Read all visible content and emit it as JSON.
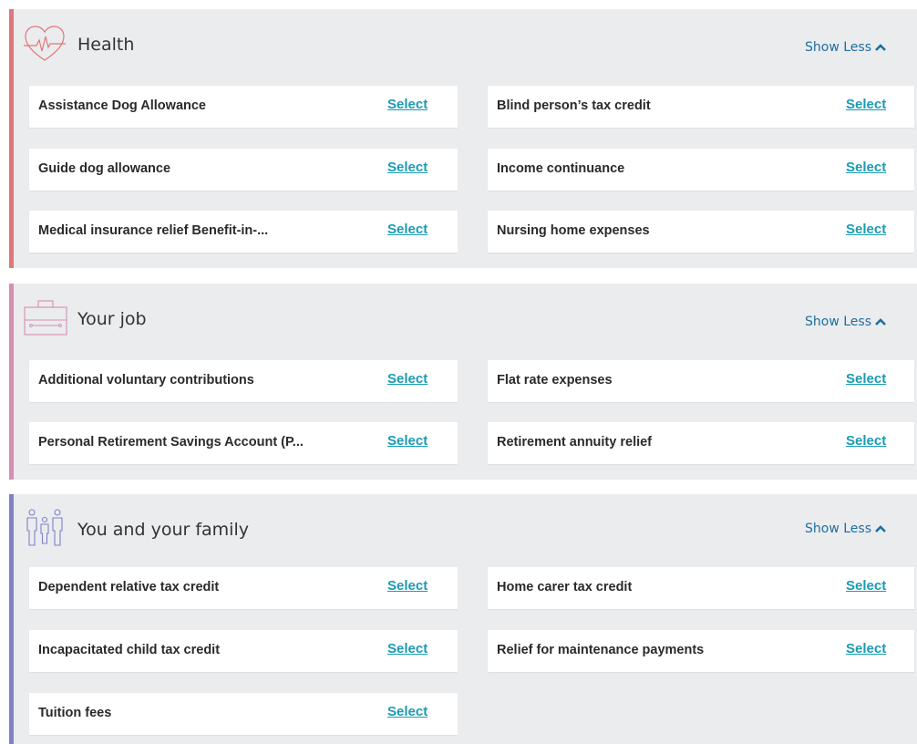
{
  "colors": {
    "health_accent": "#e0777b",
    "job_accent": "#d58fb3",
    "family_accent": "#8181c7",
    "section_bg": "#ebecee",
    "link": "#1a9bb4",
    "show_less": "#1d6f9f"
  },
  "sections": [
    {
      "title": "Health",
      "icon": "heart-pulse-icon",
      "toggle_label": "Show Less",
      "items": [
        {
          "label": "Assistance Dog Allowance",
          "action": "Select"
        },
        {
          "label": "Blind person’s tax credit",
          "action": "Select"
        },
        {
          "label": "Guide dog allowance",
          "action": "Select"
        },
        {
          "label": "Income continuance",
          "action": "Select"
        },
        {
          "label": "Medical insurance relief  Benefit-in-...",
          "action": "Select"
        },
        {
          "label": "Nursing home expenses",
          "action": "Select"
        }
      ]
    },
    {
      "title": "Your job",
      "icon": "briefcase-icon",
      "toggle_label": "Show Less",
      "items": [
        {
          "label": "Additional voluntary contributions",
          "action": "Select"
        },
        {
          "label": "Flat rate expenses",
          "action": "Select"
        },
        {
          "label": "Personal Retirement Savings Account (P...",
          "action": "Select"
        },
        {
          "label": "Retirement annuity relief",
          "action": "Select"
        }
      ]
    },
    {
      "title": "You and your family",
      "icon": "family-icon",
      "toggle_label": "Show Less",
      "items": [
        {
          "label": "Dependent relative tax credit",
          "action": "Select"
        },
        {
          "label": "Home carer tax credit",
          "action": "Select"
        },
        {
          "label": "Incapacitated child tax credit",
          "action": "Select"
        },
        {
          "label": "Relief for maintenance payments",
          "action": "Select"
        },
        {
          "label": "Tuition fees",
          "action": "Select"
        }
      ]
    }
  ]
}
